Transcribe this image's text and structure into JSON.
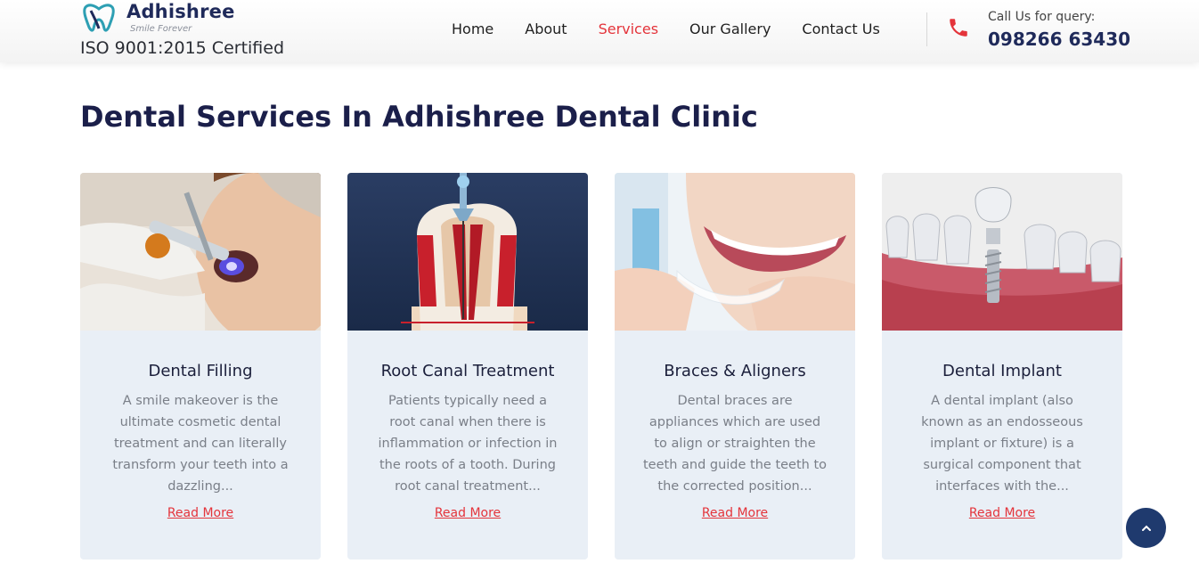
{
  "brand": {
    "name": "Adhishree",
    "tagline": "Smile Forever",
    "certification": "ISO 9001:2015 Certified"
  },
  "nav": {
    "items": [
      {
        "label": "Home",
        "active": false
      },
      {
        "label": "About",
        "active": false
      },
      {
        "label": "Services",
        "active": true
      },
      {
        "label": "Our Gallery",
        "active": false
      },
      {
        "label": "Contact Us",
        "active": false
      }
    ]
  },
  "contact": {
    "label": "Call Us for query:",
    "phone": "098266 63430"
  },
  "page": {
    "title": "Dental Services In Adhishree Dental Clinic"
  },
  "services": [
    {
      "title": "Dental Filling",
      "description": "A smile makeover is the ultimate cosmetic dental treatment and can literally transform your teeth into a dazzling...",
      "link": "Read More"
    },
    {
      "title": "Root Canal Treatment",
      "description": "Patients typically need a root canal when there is inflammation or infection in the roots of a tooth. During root canal treatment...",
      "link": "Read More"
    },
    {
      "title": "Braces & Aligners",
      "description": "Dental braces are appliances which are used to align or straighten the teeth and guide the teeth to the corrected position...",
      "link": "Read More"
    },
    {
      "title": "Dental Implant",
      "description": "A dental implant (also known as an endosseous implant or fixture) is a surgical component that interfaces with the...",
      "link": "Read More"
    }
  ],
  "colors": {
    "accent": "#e4343b",
    "navy": "#1b1f4a",
    "card_bg": "#e9eff6",
    "scroll_button": "#1f3a6e"
  },
  "icons": {
    "logo": "tooth-logo-icon",
    "phone": "phone-icon",
    "scroll_top": "chevron-up-icon"
  }
}
